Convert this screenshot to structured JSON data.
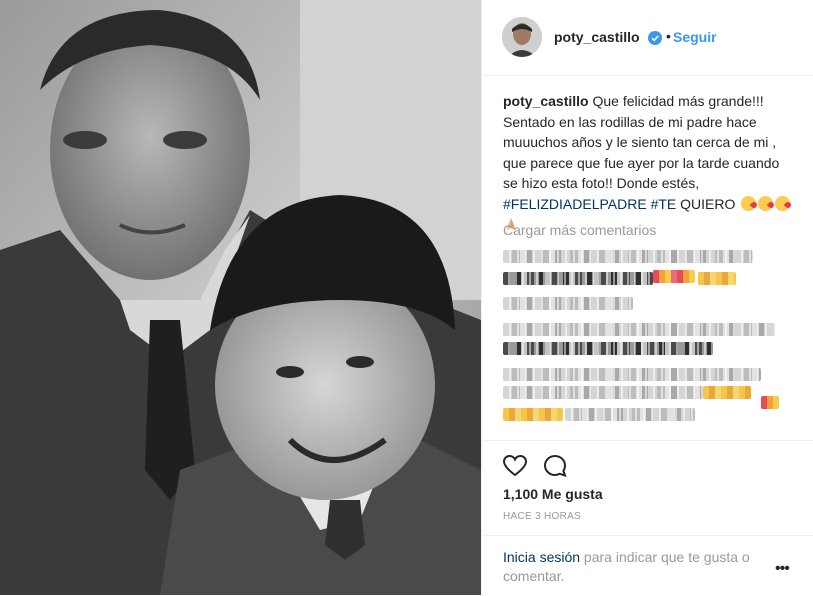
{
  "header": {
    "username": "poty_castillo",
    "separator": "•",
    "follow_label": "Seguir",
    "verified_icon": "verified-badge-icon"
  },
  "caption": {
    "username": "poty_castillo",
    "text": "Que felicidad más grande!!! Sentado en las rodillas de mi padre hace muuuchos años y le siento tan cerca de mi , que parece que fue ayer por la tarde cuando se hizo esta foto!! Donde estés, ",
    "hashtag1": "#FELIZDIADELPADRE",
    "hashtag2": "#TE",
    "word": "QUIERO",
    "emojis": [
      "kissing-heart-emoji",
      "kissing-heart-emoji",
      "kissing-heart-emoji",
      "folded-hands-emoji"
    ]
  },
  "comments": {
    "load_more_label": "Cargar más comentarios"
  },
  "actions": {
    "like_icon": "heart-icon",
    "comment_icon": "comment-icon"
  },
  "stats": {
    "likes": "1,100 Me gusta",
    "timestamp": "HACE 3 HORAS"
  },
  "login": {
    "link_label": "Inicia sesión",
    "rest": " para indicar que te gusta o comentar.",
    "more_label": "•••"
  },
  "colors": {
    "accent": "#3897f0",
    "link": "#003569",
    "muted": "#999999",
    "text": "#262626"
  }
}
